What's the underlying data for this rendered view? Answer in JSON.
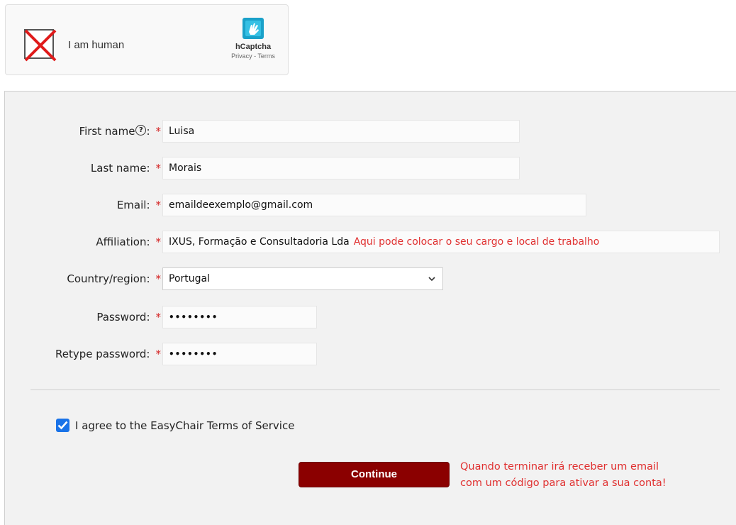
{
  "captcha": {
    "label": "I am human",
    "brand": "hCaptcha",
    "privacy_link": "Privacy",
    "separator": " - ",
    "terms_link": "Terms"
  },
  "form": {
    "required_marker": "*",
    "help_symbol": "?",
    "fields": {
      "first_name": {
        "label": "First name",
        "colon": ":",
        "value": "Luisa"
      },
      "last_name": {
        "label": "Last name:",
        "value": "Morais"
      },
      "email": {
        "label": "Email:",
        "value": "emaildeexemplo@gmail.com"
      },
      "affiliation": {
        "label": "Affiliation:",
        "value": "IXUS, Formação e Consultadoria Lda",
        "hint": "Aqui pode colocar o seu cargo e local de trabalho"
      },
      "country": {
        "label": "Country/region:",
        "value": "Portugal"
      },
      "password": {
        "label": "Password:",
        "value": "••••••••"
      },
      "retype_password": {
        "label": "Retype password:",
        "value": "••••••••"
      }
    },
    "agree": {
      "checked": true,
      "label": "I agree to the EasyChair Terms of Service"
    },
    "continue_label": "Continue",
    "after_note_line1": "Quando terminar irá receber um email",
    "after_note_line2": "com um código para ativar a sua conta!"
  },
  "colors": {
    "accent_button": "#8b0000",
    "required": "#d42020",
    "annotation": "#e03030",
    "checkbox": "#1a73e8"
  },
  "icons": {
    "captcha_status": "red-x-icon",
    "captcha_logo": "hcaptcha-hand-icon",
    "help": "question-circle-icon",
    "select": "chevron-down-icon",
    "checkbox": "checkmark-icon"
  }
}
